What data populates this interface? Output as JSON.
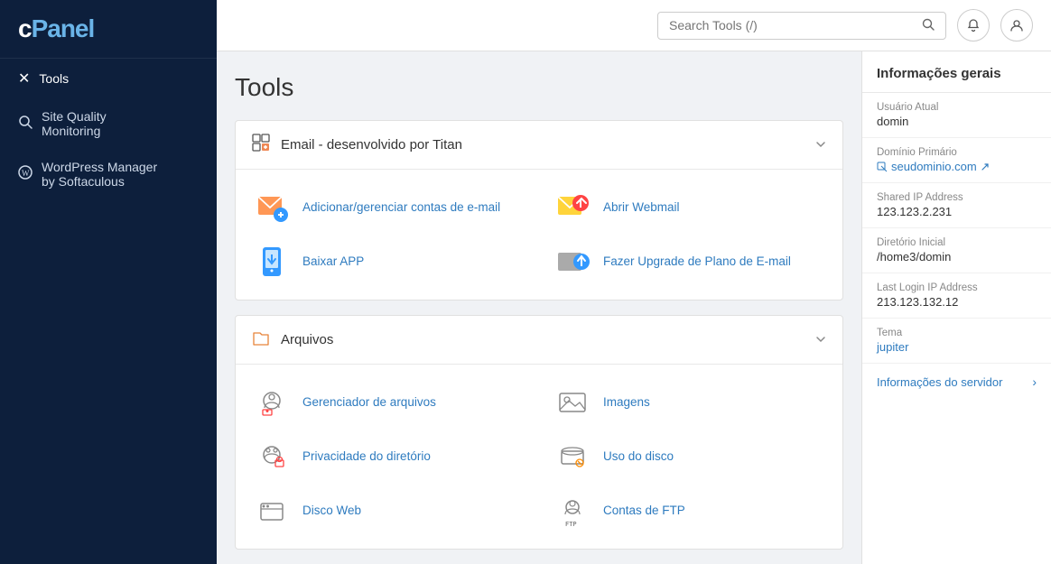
{
  "sidebar": {
    "logo": "cPanel",
    "items": [
      {
        "id": "tools",
        "label": "Tools",
        "icon": "✕",
        "active": true
      },
      {
        "id": "site-quality",
        "label": "Site Quality\nMonitoring",
        "icon": "🔍"
      },
      {
        "id": "wordpress-manager",
        "label": "WordPress Manager\nby Softaculous",
        "icon": "⊕"
      }
    ]
  },
  "header": {
    "search_placeholder": "Search Tools (/)",
    "search_icon": "🔍",
    "bell_icon": "🔔",
    "user_icon": "👤"
  },
  "page": {
    "title": "Tools"
  },
  "sections": [
    {
      "id": "email",
      "icon": "⊞",
      "title": "Email - desenvolvido por Titan",
      "tools": [
        {
          "id": "add-email",
          "label": "Adicionar/gerenciar contas de e-mail",
          "icon_type": "email"
        },
        {
          "id": "open-webmail",
          "label": "Abrir Webmail",
          "icon_type": "webmail"
        },
        {
          "id": "baixar-app",
          "label": "Baixar APP",
          "icon_type": "app"
        },
        {
          "id": "upgrade-email",
          "label": "Fazer Upgrade de Plano de E-mail",
          "icon_type": "upgrade"
        }
      ]
    },
    {
      "id": "arquivos",
      "icon": "📁",
      "title": "Arquivos",
      "tools": [
        {
          "id": "file-manager",
          "label": "Gerenciador de arquivos",
          "icon_type": "files"
        },
        {
          "id": "images",
          "label": "Imagens",
          "icon_type": "images"
        },
        {
          "id": "dir-privacy",
          "label": "Privacidade do diretório",
          "icon_type": "privacy"
        },
        {
          "id": "disk-usage",
          "label": "Uso do disco",
          "icon_type": "disk"
        },
        {
          "id": "web-disk",
          "label": "Disco Web",
          "icon_type": "webdisk"
        },
        {
          "id": "ftp-accounts",
          "label": "Contas de FTP",
          "icon_type": "ftp"
        }
      ]
    }
  ],
  "info_sidebar": {
    "title": "Informações gerais",
    "rows": [
      {
        "label": "Usuário Atual",
        "value": "domin",
        "type": "text"
      },
      {
        "label": "Domínio Primário",
        "value": "seudominio.com",
        "type": "link"
      },
      {
        "label": "Shared IP Address",
        "value": "123.123.2.231",
        "type": "text"
      },
      {
        "label": "Diretório Inicial",
        "value": "/home3/domin",
        "type": "text"
      },
      {
        "label": "Last Login IP Address",
        "value": "213.123.132.12",
        "type": "text"
      },
      {
        "label": "Tema",
        "value": "jupiter",
        "type": "highlight"
      }
    ],
    "footer_link": "Informações do servidor"
  }
}
